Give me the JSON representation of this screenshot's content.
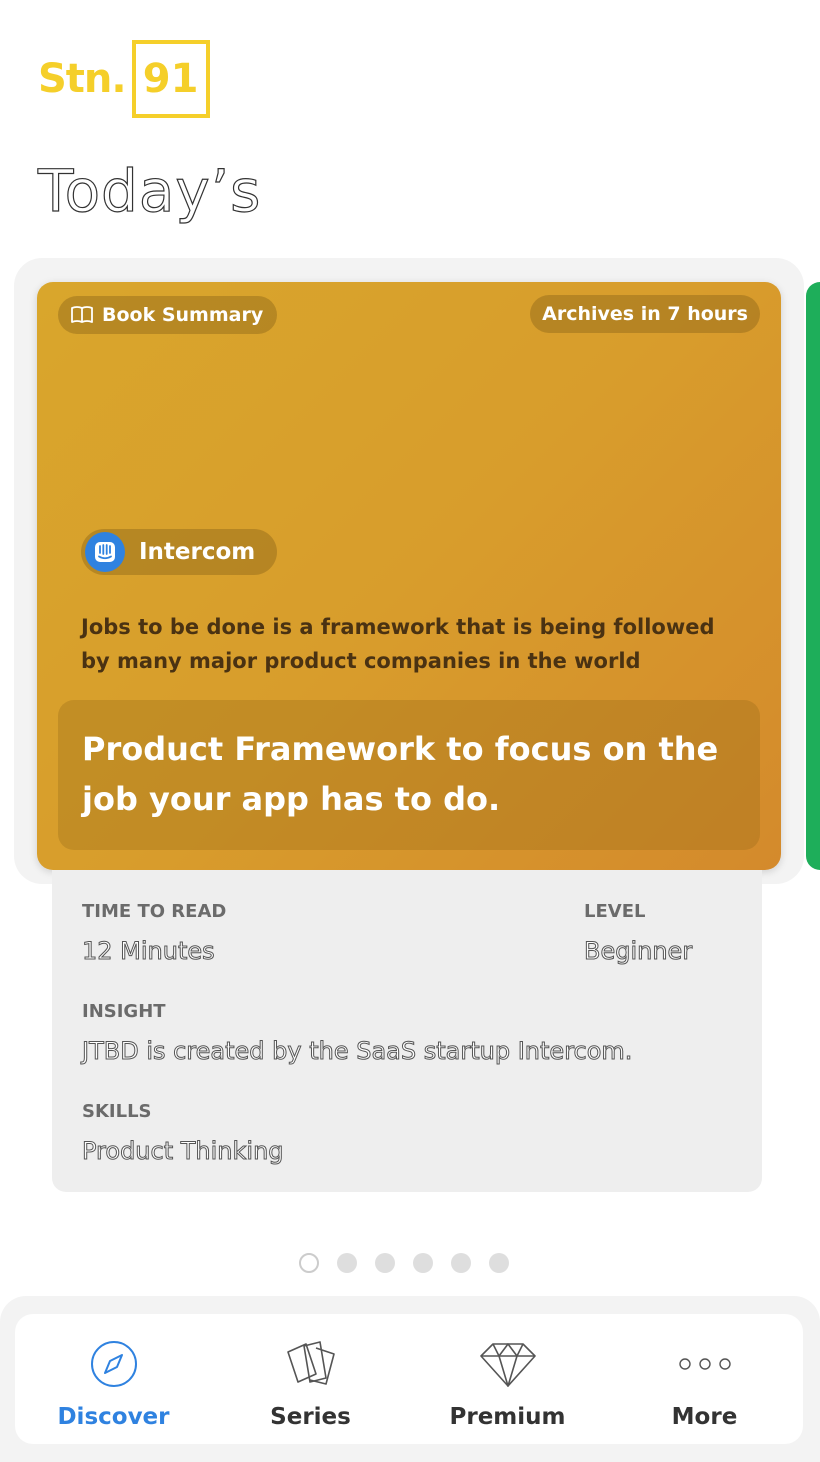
{
  "logo": {
    "text": "Stn.",
    "box_text": "91",
    "color": "#f5cf2a"
  },
  "heading": "Today’s",
  "card": {
    "category": "Book Summary",
    "category_icon": "book-icon",
    "archive_label": "Archives in 7 hours",
    "company": "Intercom",
    "company_icon": "intercom-logo",
    "description": "Jobs to be done is a framework that is being followed by many major product companies in the world",
    "title": "Product Framework to focus on the job your app has to do.",
    "colors": {
      "gradient_start": "#d9a62c",
      "gradient_end": "#d48a2c",
      "next_card": "#1eae5a"
    }
  },
  "details": {
    "time_label": "TIME TO READ",
    "time_value": "12 Minutes",
    "level_label": "LEVEL",
    "level_value": "Beginner",
    "insight_label": "INSIGHT",
    "insight_value": "JTBD is created by the SaaS startup Intercom.",
    "skills_label": "SKILLS",
    "skills_value": "Product Thinking"
  },
  "pagination": {
    "total": 6,
    "active_index": 0
  },
  "nav": {
    "items": [
      {
        "label": "Discover",
        "icon": "compass-icon",
        "active": true
      },
      {
        "label": "Series",
        "icon": "cards-icon",
        "active": false
      },
      {
        "label": "Premium",
        "icon": "diamond-icon",
        "active": false
      },
      {
        "label": "More",
        "icon": "more-dots-icon",
        "active": false
      }
    ],
    "active_color": "#2f82e0"
  }
}
